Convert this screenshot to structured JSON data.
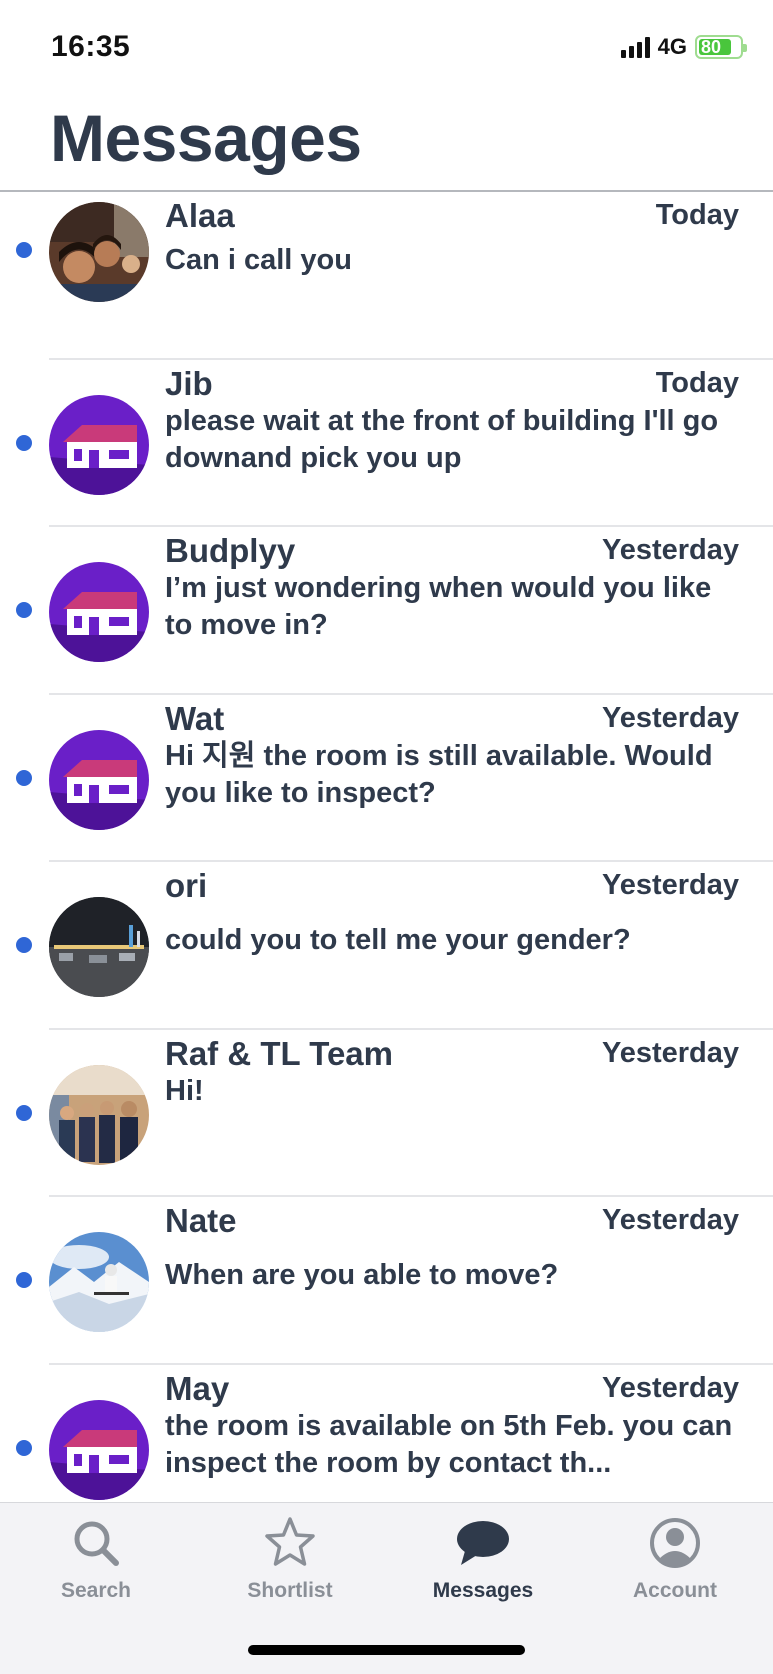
{
  "status_bar": {
    "time": "16:35",
    "network": "4G",
    "battery_level": "80",
    "battery_fraction": 0.8,
    "battery_color": "#49c63c"
  },
  "header": {
    "title": "Messages"
  },
  "colors": {
    "unread_dot": "#2f66d6",
    "text_primary": "#2f3a4b",
    "tab_inactive": "#8a8f97",
    "property_avatar_bg": "#6a1fc8"
  },
  "messages": [
    {
      "sender": "Alaa",
      "date": "Today",
      "preview": "Can i call you",
      "unread": true,
      "avatar": "photo-group-avatar"
    },
    {
      "sender": "Jib",
      "date": "Today",
      "preview": "please wait at the front of building I'll go downand pick you up",
      "unread": true,
      "avatar": "house-icon-avatar"
    },
    {
      "sender": "Budplyy",
      "date": "Yesterday",
      "preview": "I’m just wondering when would you like to move in?",
      "unread": true,
      "avatar": "house-icon-avatar"
    },
    {
      "sender": "Wat",
      "date": "Yesterday",
      "preview": "Hi 지원 the room is still available. Would you like to inspect?",
      "unread": true,
      "avatar": "house-icon-avatar"
    },
    {
      "sender": "ori",
      "date": "Yesterday",
      "preview": "could you to tell me your gender?",
      "unread": true,
      "avatar": "night-city-photo-avatar"
    },
    {
      "sender": "Raf & TL Team",
      "date": "Yesterday",
      "preview": "Hi!",
      "unread": true,
      "avatar": "team-photo-avatar"
    },
    {
      "sender": "Nate",
      "date": "Yesterday",
      "preview": "When are you able to move?",
      "unread": true,
      "avatar": "snow-mountain-photo-avatar"
    },
    {
      "sender": "May",
      "date": "Yesterday",
      "preview": "the room is available on 5th Feb. you can inspect the room by contact th...",
      "unread": true,
      "avatar": "house-icon-avatar"
    }
  ],
  "tab_bar": {
    "tabs": [
      {
        "label": "Search",
        "icon": "search-icon",
        "active": false
      },
      {
        "label": "Shortlist",
        "icon": "star-icon",
        "active": false
      },
      {
        "label": "Messages",
        "icon": "chat-bubble-icon",
        "active": true
      },
      {
        "label": "Account",
        "icon": "account-icon",
        "active": false
      }
    ]
  }
}
